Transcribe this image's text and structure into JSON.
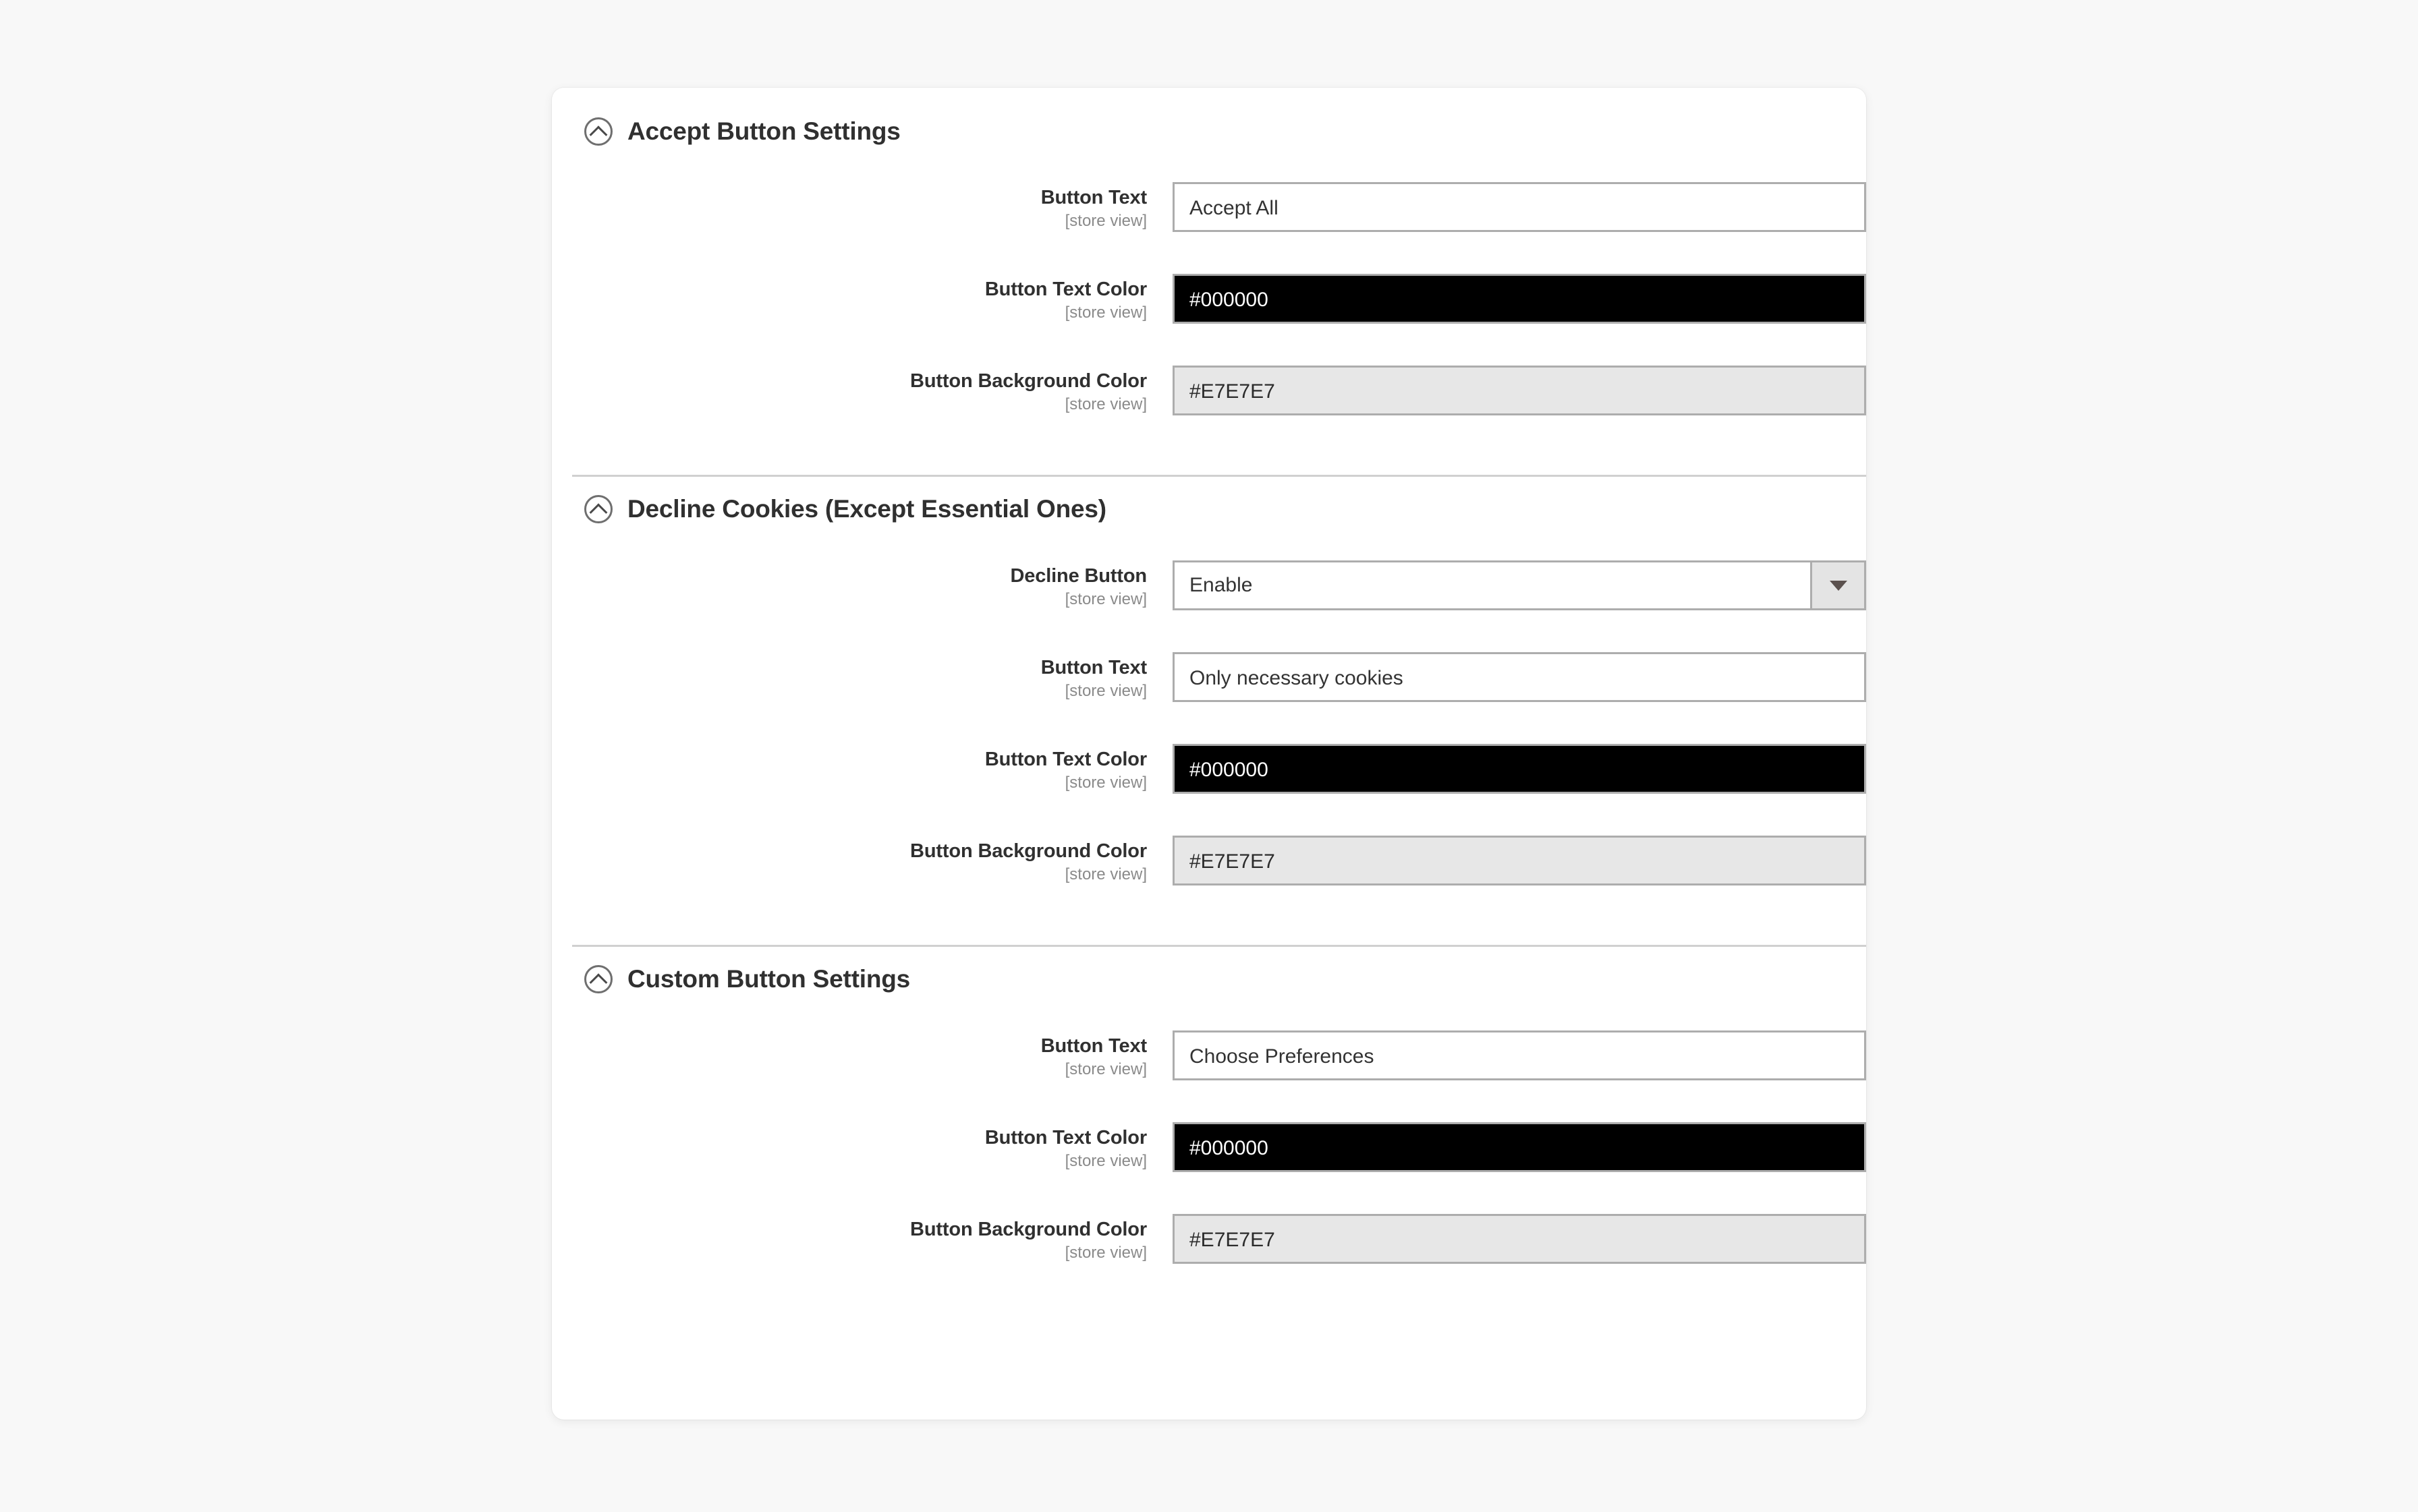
{
  "colors": {
    "page_background": "#F8F8F8",
    "panel_background": "#FFFFFF",
    "input_border": "#ADADAD",
    "divider": "#D0D0D0",
    "label_text": "#303030",
    "scope_text": "#8A8A8A",
    "swatch_dark": "#000000",
    "swatch_light": "#E7E7E7"
  },
  "scope_note": "[store view]",
  "sections": [
    {
      "id": "accept-button-settings",
      "title": "Accept Button Settings",
      "icon": "chevron-up-circle-icon",
      "fields": [
        {
          "id": "accept-button-text",
          "label": "Button Text",
          "scope": "[store view]",
          "type": "text",
          "value": "Accept All"
        },
        {
          "id": "accept-button-text-color",
          "label": "Button Text Color",
          "scope": "[store view]",
          "type": "color-dark",
          "value": "#000000"
        },
        {
          "id": "accept-button-background-color",
          "label": "Button Background Color",
          "scope": "[store view]",
          "type": "color-light",
          "value": "#E7E7E7"
        }
      ]
    },
    {
      "id": "decline-cookies-except-essential-ones",
      "title": "Decline Cookies (Except Essential Ones)",
      "icon": "chevron-up-circle-icon",
      "fields": [
        {
          "id": "decline-button",
          "label": "Decline Button",
          "scope": "[store view]",
          "type": "select",
          "value": "Enable"
        },
        {
          "id": "decline-button-text",
          "label": "Button Text",
          "scope": "[store view]",
          "type": "text",
          "value": "Only necessary cookies"
        },
        {
          "id": "decline-button-text-color",
          "label": "Button Text Color",
          "scope": "[store view]",
          "type": "color-dark",
          "value": "#000000"
        },
        {
          "id": "decline-button-background-color",
          "label": "Button Background Color",
          "scope": "[store view]",
          "type": "color-light",
          "value": "#E7E7E7"
        }
      ]
    },
    {
      "id": "custom-button-settings",
      "title": "Custom Button Settings",
      "icon": "chevron-up-circle-icon",
      "fields": [
        {
          "id": "custom-button-text",
          "label": "Button Text",
          "scope": "[store view]",
          "type": "text",
          "value": "Choose Preferences"
        },
        {
          "id": "custom-button-text-color",
          "label": "Button Text Color",
          "scope": "[store view]",
          "type": "color-dark",
          "value": "#000000"
        },
        {
          "id": "custom-button-background-color",
          "label": "Button Background Color",
          "scope": "[store view]",
          "type": "color-light",
          "value": "#E7E7E7"
        }
      ]
    }
  ]
}
